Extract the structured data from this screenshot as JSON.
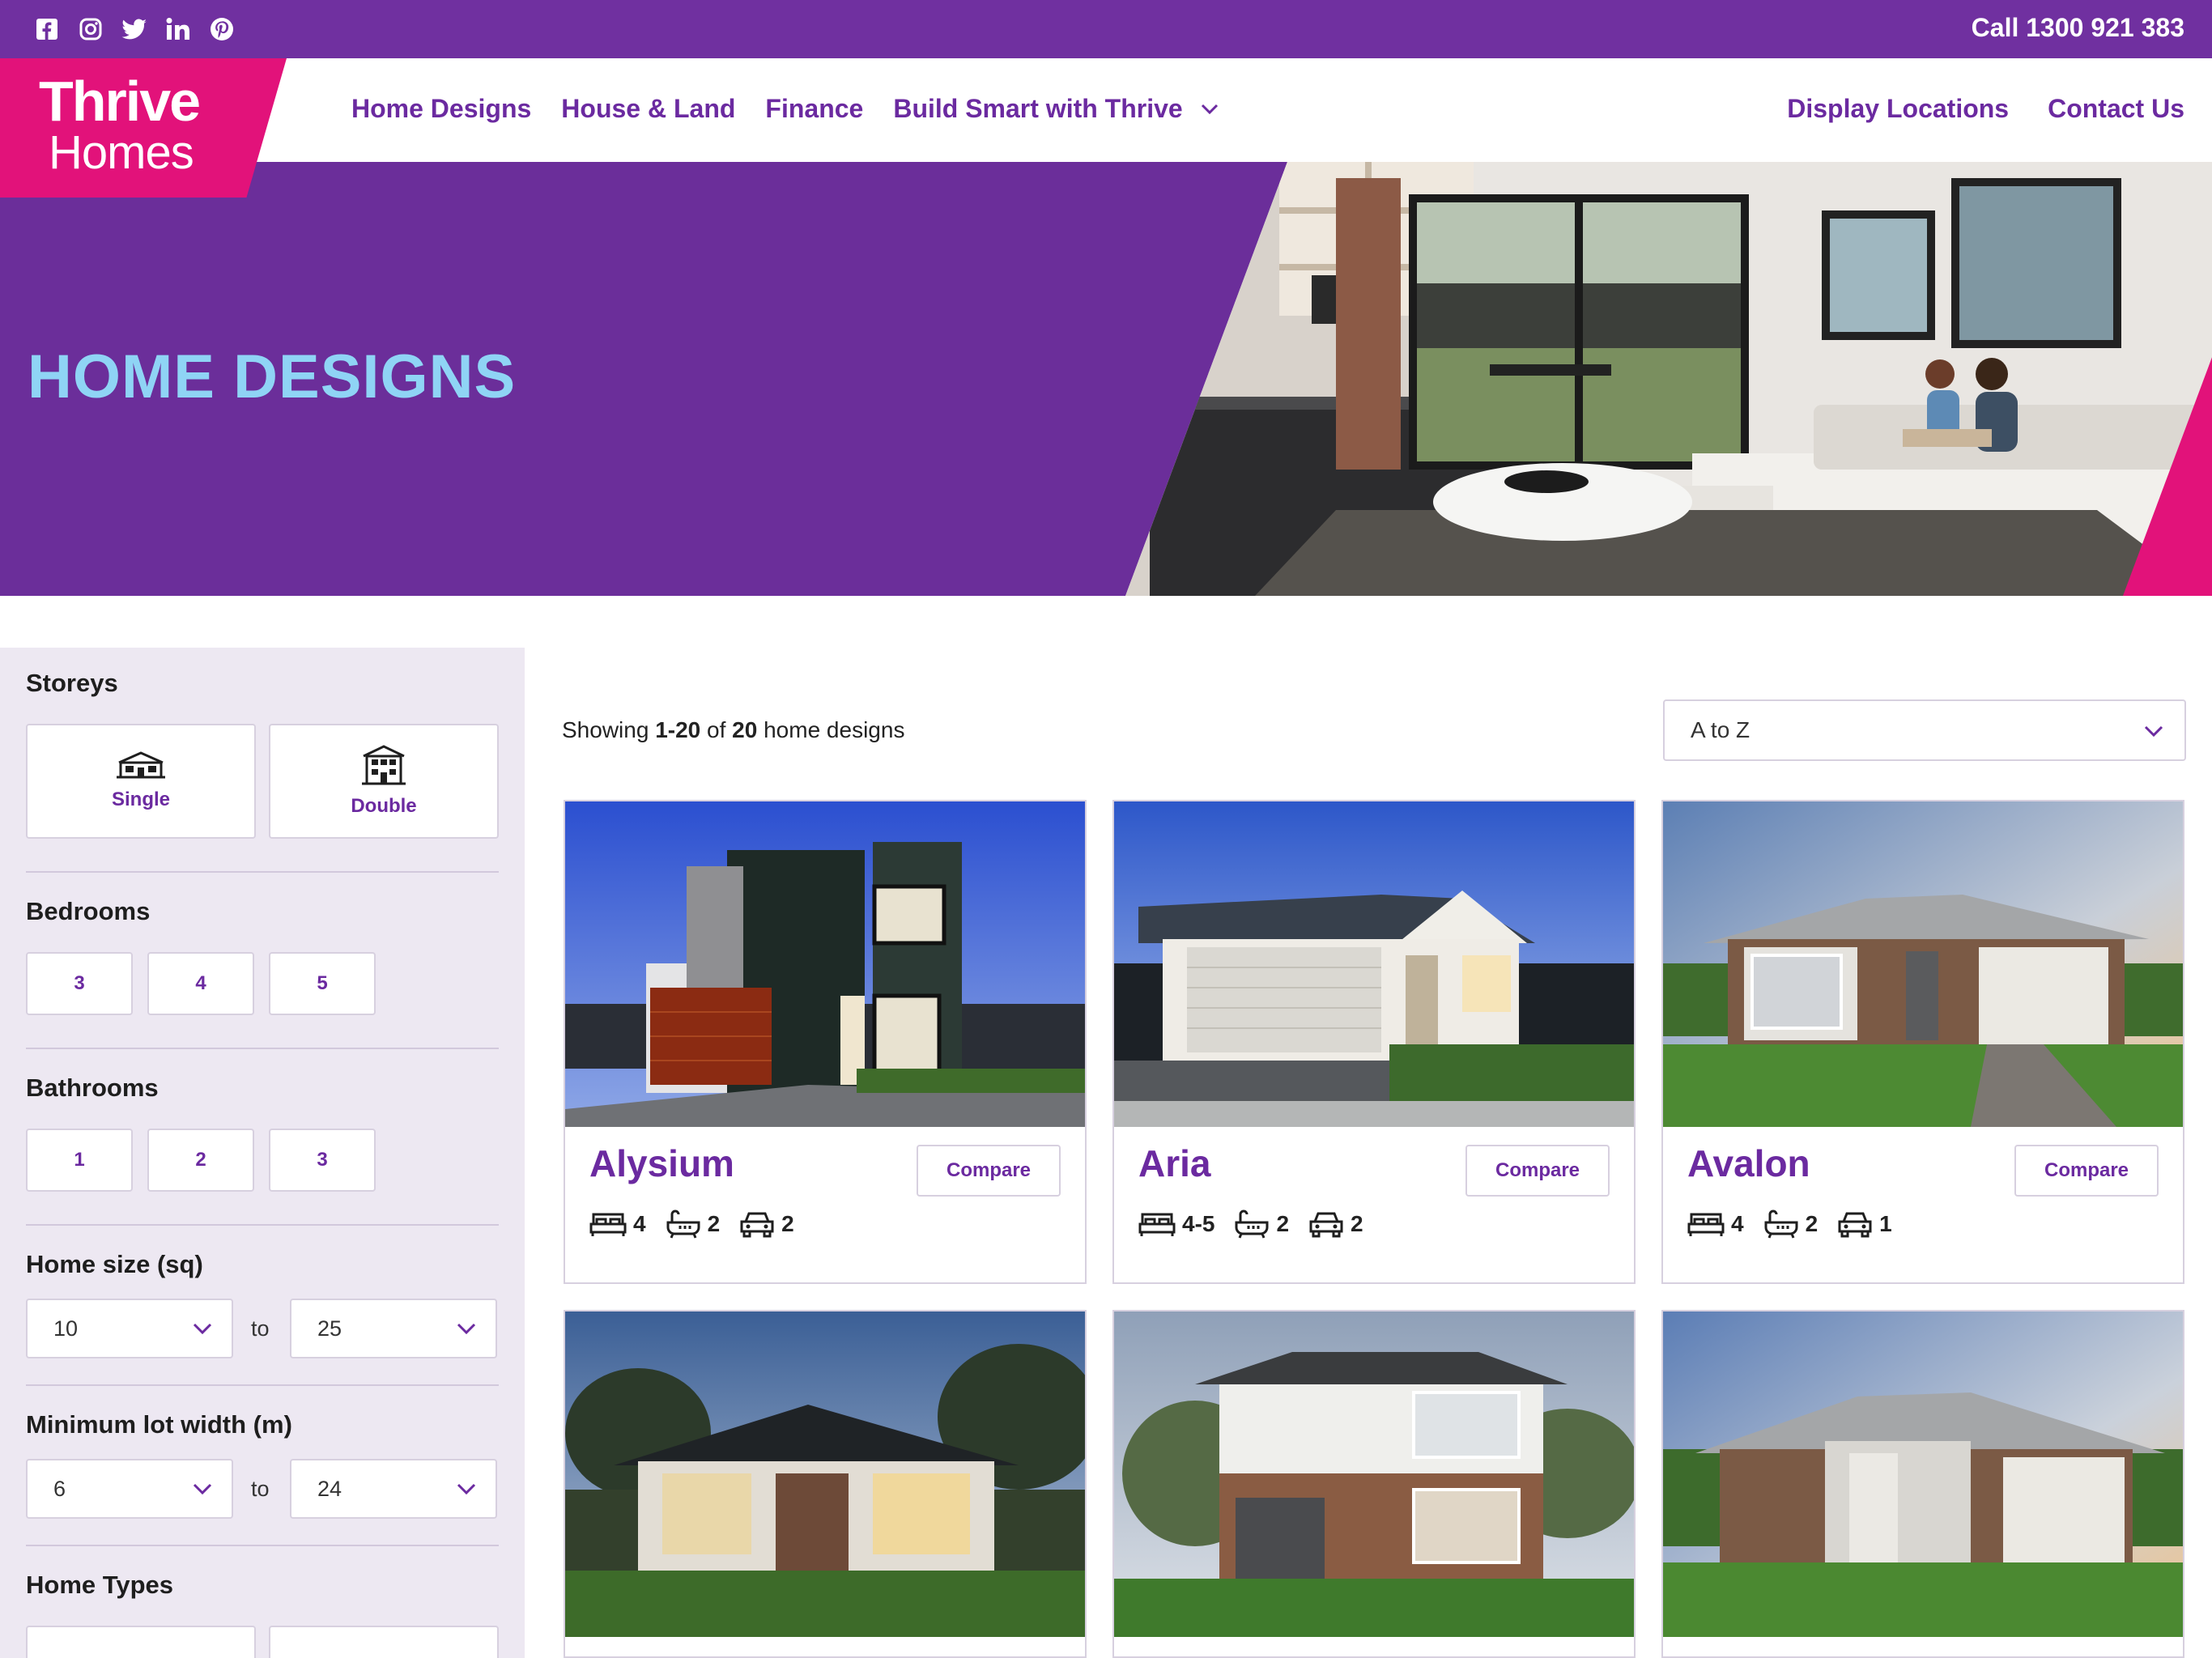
{
  "topbar": {
    "phone": "Call 1300 921 383",
    "social_icons": [
      "facebook-icon",
      "instagram-icon",
      "twitter-icon",
      "linkedin-icon",
      "pinterest-icon"
    ]
  },
  "logo": {
    "line1": "Thrive",
    "line2": "Homes"
  },
  "nav": {
    "items": [
      "Home Designs",
      "House & Land",
      "Finance",
      "Build Smart with Thrive"
    ],
    "right_items": [
      "Display Locations",
      "Contact Us"
    ]
  },
  "hero": {
    "title": "HOME DESIGNS"
  },
  "filters": {
    "storeys": {
      "title": "Storeys",
      "options": [
        "Single",
        "Double"
      ]
    },
    "bedrooms": {
      "title": "Bedrooms",
      "options": [
        "3",
        "4",
        "5"
      ]
    },
    "bathrooms": {
      "title": "Bathrooms",
      "options": [
        "1",
        "2",
        "3"
      ]
    },
    "home_size": {
      "title": "Home size (sq)",
      "min": "10",
      "max": "25",
      "to": "to"
    },
    "lot_width": {
      "title": "Minimum lot width (m)",
      "min": "6",
      "max": "24",
      "to": "to"
    },
    "home_types": {
      "title": "Home Types"
    }
  },
  "results": {
    "showing_prefix": "Showing ",
    "range_start": "1",
    "range_sep": "-",
    "range_end": "20",
    "of": " of ",
    "total": "20",
    "suffix": " home designs",
    "sort": "A to Z"
  },
  "compare_label": "Compare",
  "designs": [
    {
      "name": "Alysium",
      "beds": "4",
      "baths": "2",
      "cars": "2"
    },
    {
      "name": "Aria",
      "beds": "4-5",
      "baths": "2",
      "cars": "2"
    },
    {
      "name": "Avalon",
      "beds": "4",
      "baths": "2",
      "cars": "1"
    }
  ],
  "colors": {
    "purple": "#7030a0",
    "pink": "#e2127a",
    "hero_title": "#8fd4f5",
    "link": "#6b2aa0"
  }
}
